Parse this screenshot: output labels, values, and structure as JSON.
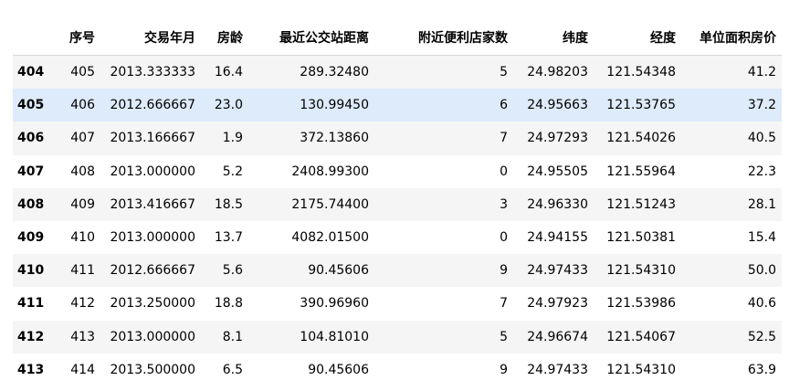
{
  "table": {
    "headers": [
      "",
      "序号",
      "交易年月",
      "房龄",
      "最近公交站距离",
      "附近便利店家数",
      "纬度",
      "经度",
      "单位面积房价"
    ],
    "rows": [
      [
        "404",
        "405",
        "2013.333333",
        "16.4",
        "289.32480",
        "5",
        "24.98203",
        "121.54348",
        "41.2"
      ],
      [
        "405",
        "406",
        "2012.666667",
        "23.0",
        "130.99450",
        "6",
        "24.95663",
        "121.53765",
        "37.2"
      ],
      [
        "406",
        "407",
        "2013.166667",
        "1.9",
        "372.13860",
        "7",
        "24.97293",
        "121.54026",
        "40.5"
      ],
      [
        "407",
        "408",
        "2013.000000",
        "5.2",
        "2408.99300",
        "0",
        "24.95505",
        "121.55964",
        "22.3"
      ],
      [
        "408",
        "409",
        "2013.416667",
        "18.5",
        "2175.74400",
        "3",
        "24.96330",
        "121.51243",
        "28.1"
      ],
      [
        "409",
        "410",
        "2013.000000",
        "13.7",
        "4082.01500",
        "0",
        "24.94155",
        "121.50381",
        "15.4"
      ],
      [
        "410",
        "411",
        "2012.666667",
        "5.6",
        "90.45606",
        "9",
        "24.97433",
        "121.54310",
        "50.0"
      ],
      [
        "411",
        "412",
        "2013.250000",
        "18.8",
        "390.96960",
        "7",
        "24.97923",
        "121.53986",
        "40.6"
      ],
      [
        "412",
        "413",
        "2013.000000",
        "8.1",
        "104.81010",
        "5",
        "24.96674",
        "121.54067",
        "52.5"
      ],
      [
        "413",
        "414",
        "2013.500000",
        "6.5",
        "90.45606",
        "9",
        "24.97433",
        "121.54310",
        "63.9"
      ]
    ]
  }
}
